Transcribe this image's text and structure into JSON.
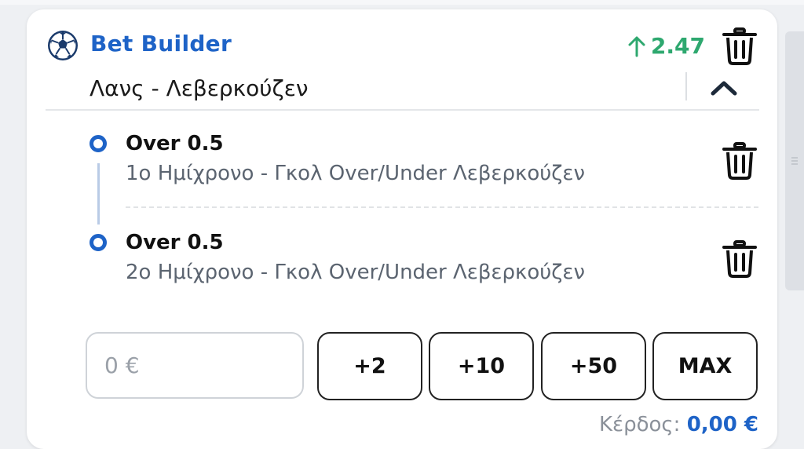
{
  "header": {
    "title": "Bet Builder",
    "odds": "2.47",
    "odds_trend_icon": "arrow-up-icon",
    "match": "Λανς - Λεβερκούζεν"
  },
  "selections": [
    {
      "title": "Over 0.5",
      "subtitle": "1ο Ημίχρονο - Γκολ Over/Under Λεβερκούζεν"
    },
    {
      "title": "Over 0.5",
      "subtitle": "2ο Ημίχρονο - Γκολ Over/Under Λεβερκούζεν"
    }
  ],
  "stake": {
    "placeholder": "0 €",
    "quick_buttons": [
      "+2",
      "+10",
      "+50",
      "MAX"
    ]
  },
  "profit": {
    "label": "Κέρδος:",
    "value": "0,00 €"
  },
  "colors": {
    "brand": "#1e63c7",
    "odds_up": "#2ea86f",
    "text": "#111111",
    "muted": "#5b6470"
  },
  "icons": [
    "soccer-ball-icon",
    "trash-icon",
    "chevron-up-icon",
    "arrow-up-icon"
  ]
}
